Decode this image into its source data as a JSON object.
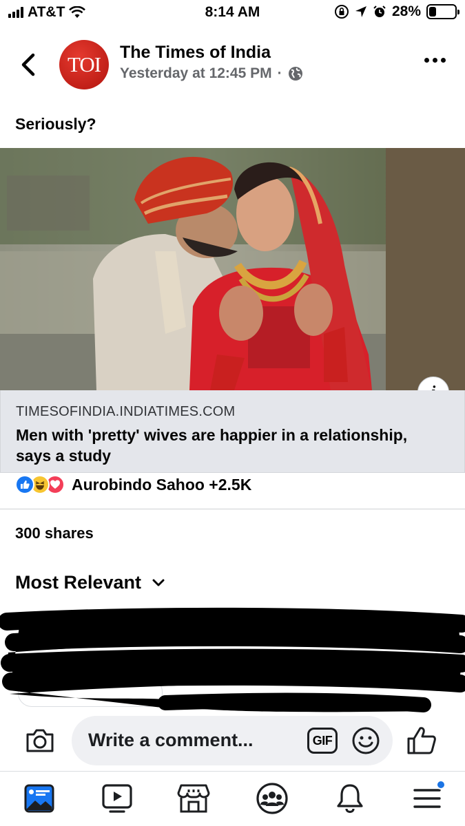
{
  "status_bar": {
    "carrier": "AT&T",
    "time": "8:14 AM",
    "battery": "28%",
    "battery_level": 0.28
  },
  "post": {
    "page_avatar_text": "TOI",
    "page_name": "The Times of India",
    "timestamp": "Yesterday at 12:45 PM",
    "separator": "·",
    "audience_icon": "globe-icon",
    "caption": "Seriously?"
  },
  "link_preview": {
    "domain": "TIMESOFINDIA.INDIATIMES.COM",
    "title": "Men with 'pretty' wives are happier in a relationship, says a study",
    "info_label": "i"
  },
  "reactions": {
    "icons": [
      "like-reaction-icon",
      "haha-reaction-icon",
      "love-reaction-icon"
    ],
    "summary": "Aurobindo Sahoo +2.5K"
  },
  "shares": "300 shares",
  "comments": {
    "sort_label": "Most Relevant"
  },
  "composer": {
    "placeholder": "Write a comment...",
    "gif_label": "GIF"
  },
  "tab_bar": {
    "tabs": [
      "news-feed-icon",
      "watch-icon",
      "marketplace-icon",
      "groups-icon",
      "notifications-icon",
      "menu-icon"
    ]
  },
  "colors": {
    "brand_blue": "#1877f2",
    "secondary_text": "#65676b",
    "link_box_bg": "#e4e6eb",
    "avatar_red": "#c8211a"
  }
}
